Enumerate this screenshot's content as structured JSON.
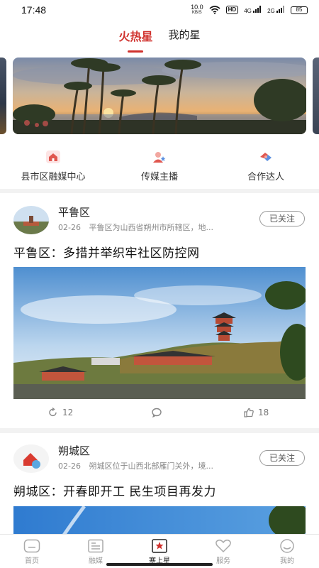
{
  "status_bar": {
    "time": "17:48",
    "net_speed": "10.0",
    "net_unit": "KB/S",
    "hd_label": "HD",
    "sig1_label": "4G",
    "sig2_label": "2G",
    "battery": "85"
  },
  "top_tabs": [
    {
      "label": "火热星"
    },
    {
      "label": "我的星"
    }
  ],
  "quick_links": [
    {
      "label": "县市区融媒中心",
      "icon": "house-icon"
    },
    {
      "label": "传媒主播",
      "icon": "person-star-icon"
    },
    {
      "label": "合作达人",
      "icon": "handshake-icon"
    }
  ],
  "feed": [
    {
      "source_name": "平鲁区",
      "date": "02-26",
      "description": "平鲁区为山西省朔州市所辖区，地...",
      "follow_label": "已关注",
      "headline": "平鲁区：多措并举织牢社区防控网",
      "reposts": "12",
      "comments": "",
      "likes": "18"
    },
    {
      "source_name": "朔城区",
      "date": "02-26",
      "description": "朔城区位于山西北部雁门关外，境...",
      "follow_label": "已关注",
      "headline": "朔城区：开春即开工 民生项目再发力"
    }
  ],
  "bottom_nav": [
    {
      "label": "首页",
      "icon": "home-icon"
    },
    {
      "label": "融媒",
      "icon": "news-icon"
    },
    {
      "label": "塞上星",
      "icon": "star-flag-icon"
    },
    {
      "label": "服务",
      "icon": "heart-icon"
    },
    {
      "label": "我的",
      "icon": "profile-icon"
    }
  ],
  "colors": {
    "accent": "#d0312d",
    "background": "#f2f2f2"
  }
}
